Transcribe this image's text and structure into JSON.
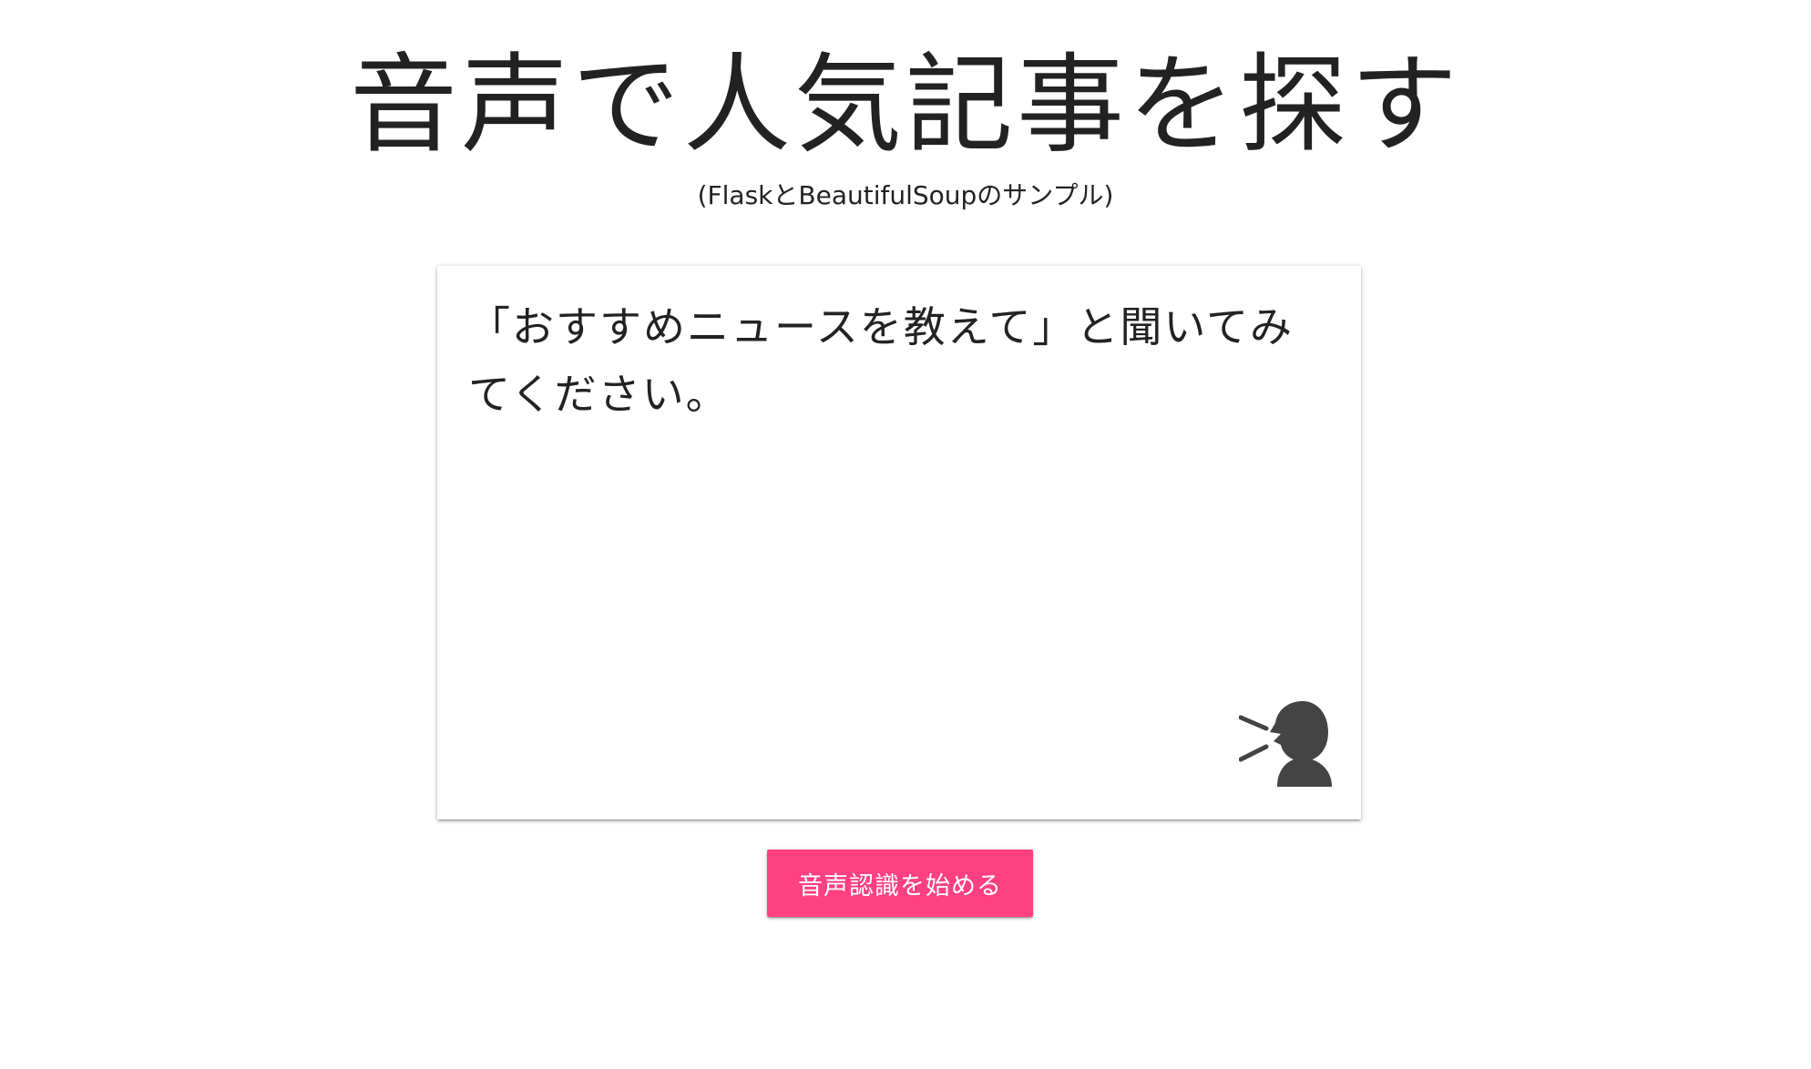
{
  "header": {
    "title": "音声で人気記事を探す",
    "subtitle": "(FlaskとBeautifulSoupのサンプル)"
  },
  "card": {
    "prompt_text": "「おすすめニュースを教えて」と聞いてみてください。",
    "icon": "speaking-person-icon"
  },
  "actions": {
    "start_button_label": "音声認識を始める"
  },
  "colors": {
    "accent": "#ff4081",
    "icon": "#444444",
    "text": "#222222"
  }
}
